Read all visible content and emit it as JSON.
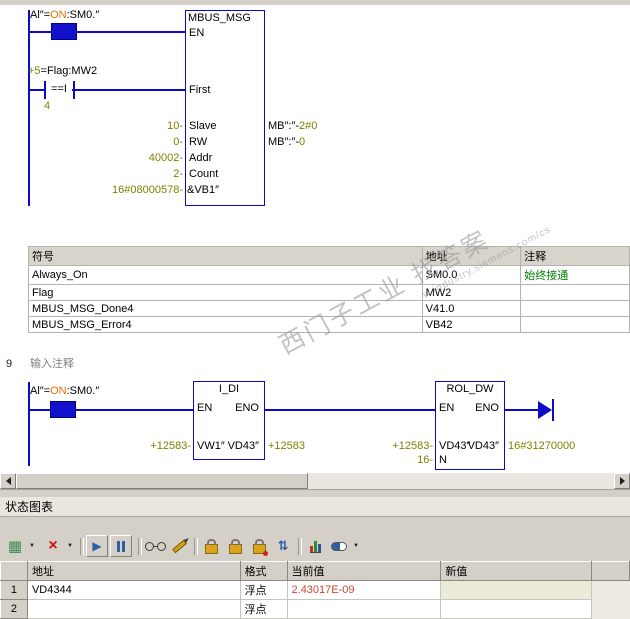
{
  "colors": {
    "wire_blue": "#0a0ac8",
    "value_olive": "#808000",
    "on_state_orange": "#e86c00",
    "comment_green": "#008000",
    "current_value_red": "#cc4433",
    "ui_gray": "#d4d0c8"
  },
  "watermark": {
    "line1": "西门子工业  找答案",
    "line2": "w.industry.siemens.com/cs"
  },
  "network1": {
    "contact": {
      "pre": "Al″=",
      "on": "ON",
      "post": ":SM0.″"
    },
    "compare": {
      "label_value": "+5",
      "label_operand": "=Flag:MW2",
      "op": "==I",
      "value": "4"
    },
    "block": {
      "title": "MBUS_MSG",
      "pin_en": "EN",
      "pin_first": "First",
      "pin_slave": "Slave",
      "pin_rw": "RW",
      "pin_addr": "Addr",
      "pin_count": "Count",
      "pin_data_operand": "&VB1″",
      "val_slave": "10-",
      "val_rw": "0-",
      "val_addr": "40002-",
      "val_count": "2-",
      "val_data": "16#08000578-",
      "out_done_label": "MB″:″-",
      "out_done_value": "2#0",
      "out_error_label": "MB″:″-",
      "out_error_value": "0"
    }
  },
  "symbol_table": {
    "headers": [
      "符号",
      "地址",
      "注释"
    ],
    "rows": [
      {
        "symbol": "Always_On",
        "address": "SM0.0",
        "comment": "始终接通"
      },
      {
        "symbol": "Flag",
        "address": "MW2",
        "comment": ""
      },
      {
        "symbol": "MBUS_MSG_Done4",
        "address": "V41.0",
        "comment": ""
      },
      {
        "symbol": "MBUS_MSG_Error4",
        "address": "VB42",
        "comment": ""
      }
    ]
  },
  "network9": {
    "number": "9",
    "comment": "输入注释",
    "contact": {
      "pre": "Al″=",
      "on": "ON",
      "post": ":SM0.″"
    },
    "idi": {
      "title": "I_DI",
      "en": "EN",
      "eno": "ENO",
      "in_value": "+12583-",
      "in_operand": "VW1″",
      "out_operand": "VD43″",
      "out_value": "+12583"
    },
    "rol": {
      "title": "ROL_DW",
      "en": "EN",
      "eno": "ENO",
      "in_value": "+12583-",
      "in_operand": "VD43″",
      "out_operand": "VD43″",
      "out_value": "16#31270000",
      "n_value": "16-",
      "n_pin": "N"
    }
  },
  "status_pane": {
    "title": "状态图表",
    "toolbar": {
      "new_glyph": "▦",
      "drop_glyph": "▼",
      "delete_glyph": "×",
      "play_glyph": "▶",
      "sort_glyph": "⇅"
    },
    "table": {
      "headers": [
        "地址",
        "格式",
        "当前值",
        "新值"
      ],
      "rows": [
        {
          "num": "1",
          "address": "VD4344",
          "format": "浮点",
          "current": "2.43017E-09",
          "new_value": ""
        },
        {
          "num": "2",
          "address": "",
          "format": "浮点",
          "current": "",
          "new_value": ""
        }
      ]
    }
  }
}
